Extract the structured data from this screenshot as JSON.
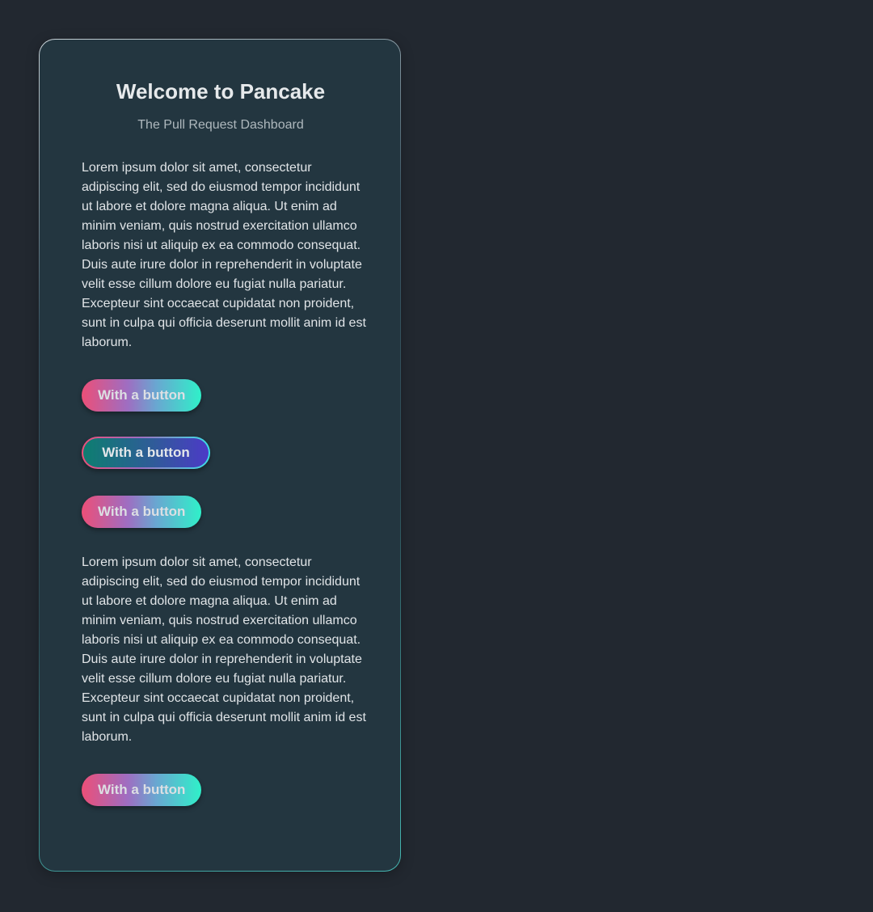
{
  "card": {
    "title": "Welcome to Pancake",
    "subtitle": "The Pull Request Dashboard",
    "paragraph_1": "Lorem ipsum dolor sit amet, consectetur adipiscing elit, sed do eiusmod tempor incididunt ut labore et dolore magna aliqua. Ut enim ad minim veniam, quis nostrud exercitation ullamco laboris nisi ut aliquip ex ea commodo consequat. Duis aute irure dolor in reprehenderit in voluptate velit esse cillum dolore eu fugiat nulla pariatur. Excepteur sint occaecat cupidatat non proident, sunt in culpa qui officia deserunt mollit anim id est laborum.",
    "paragraph_2": "Lorem ipsum dolor sit amet, consectetur adipiscing elit, sed do eiusmod tempor incididunt ut labore et dolore magna aliqua. Ut enim ad minim veniam, quis nostrud exercitation ullamco laboris nisi ut aliquip ex ea commodo consequat. Duis aute irure dolor in reprehenderit in voluptate velit esse cillum dolore eu fugiat nulla pariatur. Excepteur sint occaecat cupidatat non proident, sunt in culpa qui officia deserunt mollit anim id est laborum.",
    "buttons": [
      {
        "label": "With a button"
      },
      {
        "label": "With a button"
      },
      {
        "label": "With a button"
      },
      {
        "label": "With a button"
      }
    ]
  },
  "colors": {
    "page_background": "#222830",
    "card_background": "#233640",
    "gradient_start": "#ec4f78",
    "gradient_end": "#2ff0c9",
    "outlined_gradient_start": "#0d7e70",
    "outlined_gradient_end": "#4c3ac7"
  }
}
